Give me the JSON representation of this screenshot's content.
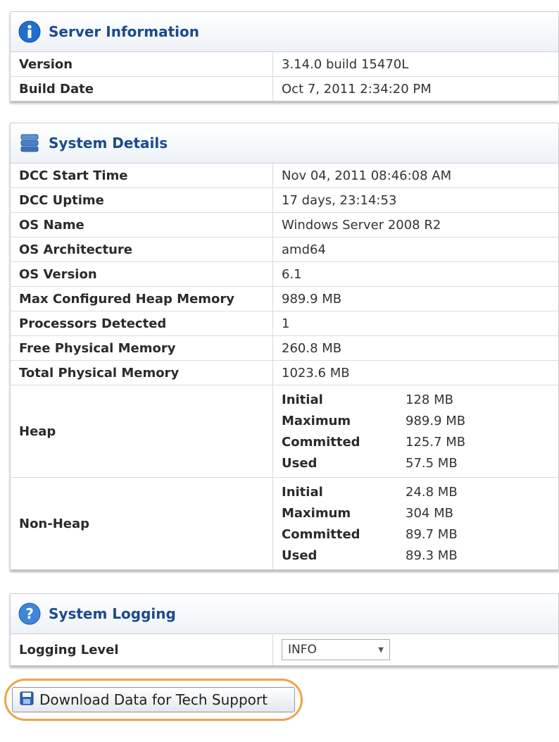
{
  "server_info": {
    "title": "Server Information",
    "icon": "info-icon",
    "rows": [
      {
        "label": "Version",
        "value": "3.14.0 build 15470L"
      },
      {
        "label": "Build Date",
        "value": "Oct 7, 2011 2:34:20 PM"
      }
    ]
  },
  "system_details": {
    "title": "System Details",
    "icon": "database-icon",
    "rows": [
      {
        "label": "DCC Start Time",
        "value": "Nov 04, 2011 08:46:08 AM"
      },
      {
        "label": "DCC Uptime",
        "value": "17 days, 23:14:53"
      },
      {
        "label": "OS Name",
        "value": "Windows Server 2008 R2"
      },
      {
        "label": "OS Architecture",
        "value": "amd64"
      },
      {
        "label": "OS Version",
        "value": "6.1"
      },
      {
        "label": "Max Configured Heap Memory",
        "value": "989.9 MB"
      },
      {
        "label": "Processors Detected",
        "value": "1"
      },
      {
        "label": "Free Physical Memory",
        "value": "260.8 MB"
      },
      {
        "label": "Total Physical Memory",
        "value": "1023.6 MB"
      }
    ],
    "heap": {
      "label": "Heap",
      "items": [
        {
          "k": "Initial",
          "v": "128 MB"
        },
        {
          "k": "Maximum",
          "v": "989.9 MB"
        },
        {
          "k": "Committed",
          "v": "125.7 MB"
        },
        {
          "k": "Used",
          "v": "57.5 MB"
        }
      ]
    },
    "non_heap": {
      "label": "Non-Heap",
      "items": [
        {
          "k": "Initial",
          "v": "24.8 MB"
        },
        {
          "k": "Maximum",
          "v": "304 MB"
        },
        {
          "k": "Committed",
          "v": "89.7 MB"
        },
        {
          "k": "Used",
          "v": "89.3 MB"
        }
      ]
    }
  },
  "system_logging": {
    "title": "System Logging",
    "icon": "help-icon",
    "logging_level_label": "Logging Level",
    "logging_level_value": "INFO"
  },
  "download_button": {
    "label": "Download Data for Tech Support",
    "icon": "save-disk-icon",
    "highlight_color": "#f0a24a"
  },
  "colors": {
    "header_text": "#1c4a8c",
    "border": "#c9ced6"
  }
}
